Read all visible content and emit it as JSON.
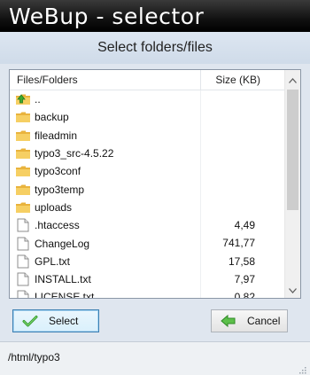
{
  "window": {
    "title": "WeBup - selector",
    "subtitle": "Select folders/files"
  },
  "list": {
    "columns": {
      "name": "Files/Folders",
      "size": "Size (KB)"
    },
    "rows": [
      {
        "name": "..",
        "size": "",
        "kind": "folder-up"
      },
      {
        "name": "backup",
        "size": "",
        "kind": "folder"
      },
      {
        "name": "fileadmin",
        "size": "",
        "kind": "folder"
      },
      {
        "name": "typo3_src-4.5.22",
        "size": "",
        "kind": "folder"
      },
      {
        "name": "typo3conf",
        "size": "",
        "kind": "folder"
      },
      {
        "name": "typo3temp",
        "size": "",
        "kind": "folder"
      },
      {
        "name": "uploads",
        "size": "",
        "kind": "folder"
      },
      {
        "name": ".htaccess",
        "size": "4,49",
        "kind": "file"
      },
      {
        "name": "ChangeLog",
        "size": "741,77",
        "kind": "file"
      },
      {
        "name": "GPL.txt",
        "size": "17,58",
        "kind": "file"
      },
      {
        "name": "INSTALL.txt",
        "size": "7,97",
        "kind": "file"
      },
      {
        "name": "LICENSE.txt",
        "size": "0,82",
        "kind": "file"
      }
    ]
  },
  "buttons": {
    "select_label": "Select",
    "cancel_label": "Cancel"
  },
  "status": {
    "path": "/html/typo3"
  },
  "icons": {
    "folder": "folder-icon",
    "folder_up": "folder-up-icon",
    "file": "file-icon",
    "select": "checkmark-icon",
    "cancel": "arrow-left-icon"
  },
  "colors": {
    "titlebar": "#000000",
    "folder": "#f2c04b",
    "select_border": "#3c7fb1",
    "check": "#3aa834",
    "cancel_arrow": "#4cae3c"
  }
}
